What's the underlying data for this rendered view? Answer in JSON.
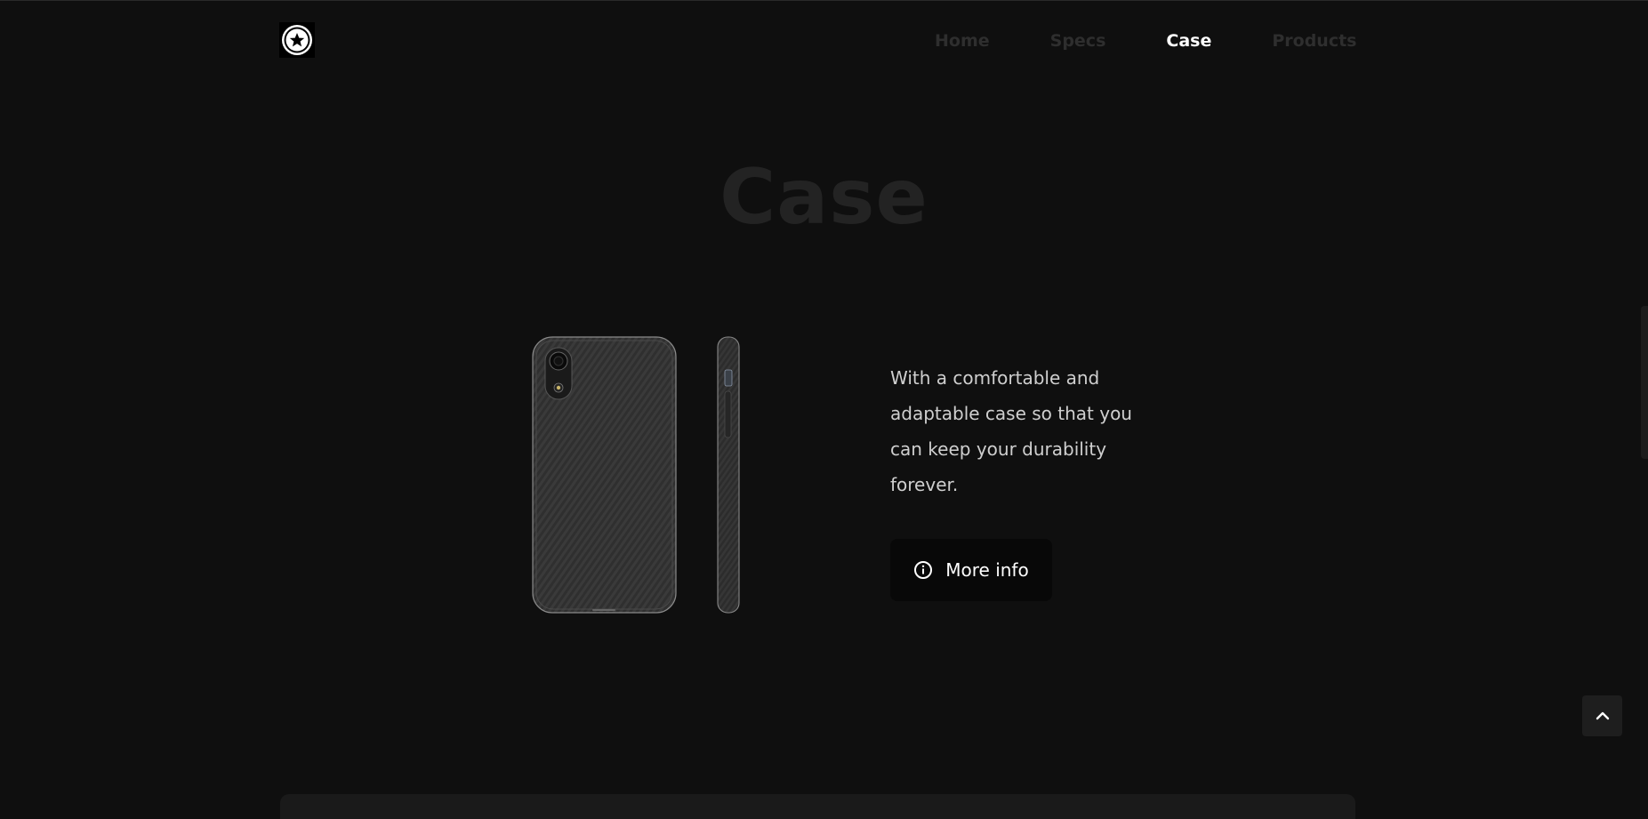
{
  "header": {
    "logo_icon": "star-circle-icon",
    "nav": [
      {
        "label": "Home",
        "active": false
      },
      {
        "label": "Specs",
        "active": false
      },
      {
        "label": "Case",
        "active": true
      },
      {
        "label": "Products",
        "active": false
      }
    ]
  },
  "section": {
    "title": "Case",
    "description": "With a comfortable and adaptable case so that you can keep your durability forever.",
    "button": {
      "label": "More info",
      "icon": "info-circle-icon"
    }
  },
  "scroll_top": {
    "icon": "chevron-up-icon"
  },
  "colors": {
    "background": "#0f0f0f",
    "nav_inactive": "#2e2e2e",
    "nav_active": "#ffffff",
    "title": "#232323",
    "text": "#cfcfcf",
    "button_bg": "#080808"
  }
}
